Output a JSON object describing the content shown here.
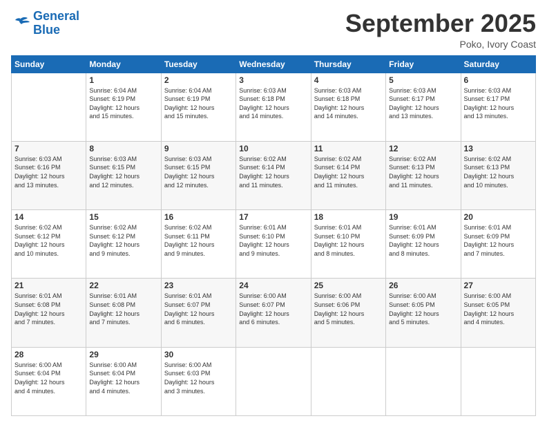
{
  "header": {
    "logo_line1": "General",
    "logo_line2": "Blue",
    "month": "September 2025",
    "location": "Poko, Ivory Coast"
  },
  "days_of_week": [
    "Sunday",
    "Monday",
    "Tuesday",
    "Wednesday",
    "Thursday",
    "Friday",
    "Saturday"
  ],
  "weeks": [
    [
      {
        "num": "",
        "info": ""
      },
      {
        "num": "1",
        "info": "Sunrise: 6:04 AM\nSunset: 6:19 PM\nDaylight: 12 hours\nand 15 minutes."
      },
      {
        "num": "2",
        "info": "Sunrise: 6:04 AM\nSunset: 6:19 PM\nDaylight: 12 hours\nand 15 minutes."
      },
      {
        "num": "3",
        "info": "Sunrise: 6:03 AM\nSunset: 6:18 PM\nDaylight: 12 hours\nand 14 minutes."
      },
      {
        "num": "4",
        "info": "Sunrise: 6:03 AM\nSunset: 6:18 PM\nDaylight: 12 hours\nand 14 minutes."
      },
      {
        "num": "5",
        "info": "Sunrise: 6:03 AM\nSunset: 6:17 PM\nDaylight: 12 hours\nand 13 minutes."
      },
      {
        "num": "6",
        "info": "Sunrise: 6:03 AM\nSunset: 6:17 PM\nDaylight: 12 hours\nand 13 minutes."
      }
    ],
    [
      {
        "num": "7",
        "info": "Sunrise: 6:03 AM\nSunset: 6:16 PM\nDaylight: 12 hours\nand 13 minutes."
      },
      {
        "num": "8",
        "info": "Sunrise: 6:03 AM\nSunset: 6:15 PM\nDaylight: 12 hours\nand 12 minutes."
      },
      {
        "num": "9",
        "info": "Sunrise: 6:03 AM\nSunset: 6:15 PM\nDaylight: 12 hours\nand 12 minutes."
      },
      {
        "num": "10",
        "info": "Sunrise: 6:02 AM\nSunset: 6:14 PM\nDaylight: 12 hours\nand 11 minutes."
      },
      {
        "num": "11",
        "info": "Sunrise: 6:02 AM\nSunset: 6:14 PM\nDaylight: 12 hours\nand 11 minutes."
      },
      {
        "num": "12",
        "info": "Sunrise: 6:02 AM\nSunset: 6:13 PM\nDaylight: 12 hours\nand 11 minutes."
      },
      {
        "num": "13",
        "info": "Sunrise: 6:02 AM\nSunset: 6:13 PM\nDaylight: 12 hours\nand 10 minutes."
      }
    ],
    [
      {
        "num": "14",
        "info": "Sunrise: 6:02 AM\nSunset: 6:12 PM\nDaylight: 12 hours\nand 10 minutes."
      },
      {
        "num": "15",
        "info": "Sunrise: 6:02 AM\nSunset: 6:12 PM\nDaylight: 12 hours\nand 9 minutes."
      },
      {
        "num": "16",
        "info": "Sunrise: 6:02 AM\nSunset: 6:11 PM\nDaylight: 12 hours\nand 9 minutes."
      },
      {
        "num": "17",
        "info": "Sunrise: 6:01 AM\nSunset: 6:10 PM\nDaylight: 12 hours\nand 9 minutes."
      },
      {
        "num": "18",
        "info": "Sunrise: 6:01 AM\nSunset: 6:10 PM\nDaylight: 12 hours\nand 8 minutes."
      },
      {
        "num": "19",
        "info": "Sunrise: 6:01 AM\nSunset: 6:09 PM\nDaylight: 12 hours\nand 8 minutes."
      },
      {
        "num": "20",
        "info": "Sunrise: 6:01 AM\nSunset: 6:09 PM\nDaylight: 12 hours\nand 7 minutes."
      }
    ],
    [
      {
        "num": "21",
        "info": "Sunrise: 6:01 AM\nSunset: 6:08 PM\nDaylight: 12 hours\nand 7 minutes."
      },
      {
        "num": "22",
        "info": "Sunrise: 6:01 AM\nSunset: 6:08 PM\nDaylight: 12 hours\nand 7 minutes."
      },
      {
        "num": "23",
        "info": "Sunrise: 6:01 AM\nSunset: 6:07 PM\nDaylight: 12 hours\nand 6 minutes."
      },
      {
        "num": "24",
        "info": "Sunrise: 6:00 AM\nSunset: 6:07 PM\nDaylight: 12 hours\nand 6 minutes."
      },
      {
        "num": "25",
        "info": "Sunrise: 6:00 AM\nSunset: 6:06 PM\nDaylight: 12 hours\nand 5 minutes."
      },
      {
        "num": "26",
        "info": "Sunrise: 6:00 AM\nSunset: 6:05 PM\nDaylight: 12 hours\nand 5 minutes."
      },
      {
        "num": "27",
        "info": "Sunrise: 6:00 AM\nSunset: 6:05 PM\nDaylight: 12 hours\nand 4 minutes."
      }
    ],
    [
      {
        "num": "28",
        "info": "Sunrise: 6:00 AM\nSunset: 6:04 PM\nDaylight: 12 hours\nand 4 minutes."
      },
      {
        "num": "29",
        "info": "Sunrise: 6:00 AM\nSunset: 6:04 PM\nDaylight: 12 hours\nand 4 minutes."
      },
      {
        "num": "30",
        "info": "Sunrise: 6:00 AM\nSunset: 6:03 PM\nDaylight: 12 hours\nand 3 minutes."
      },
      {
        "num": "",
        "info": ""
      },
      {
        "num": "",
        "info": ""
      },
      {
        "num": "",
        "info": ""
      },
      {
        "num": "",
        "info": ""
      }
    ]
  ]
}
